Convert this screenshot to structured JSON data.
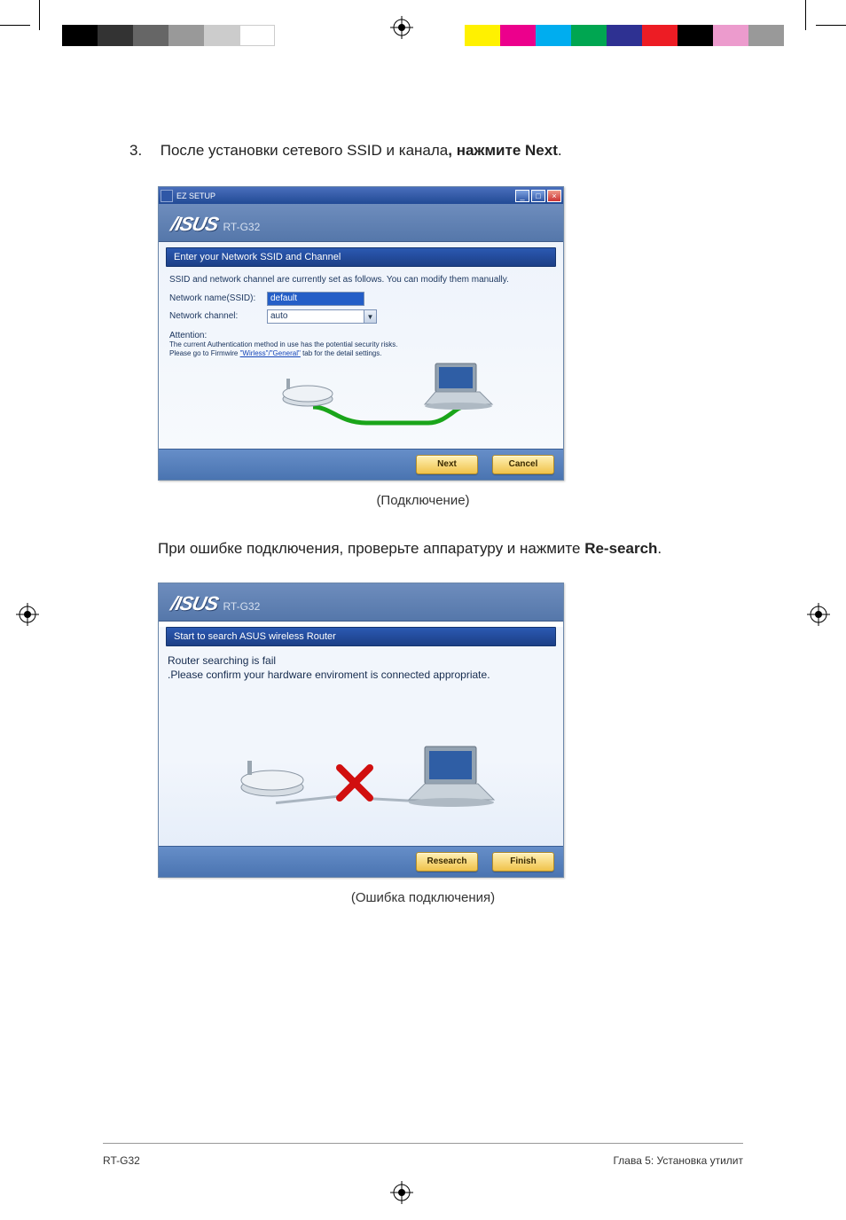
{
  "step": {
    "number": "3.",
    "text_before": "После установки сетевого SSID и канала",
    "text_bold1": ", нажмите ",
    "text_bold2": "Next",
    "text_after": "."
  },
  "shot1": {
    "window_title": "EZ SETUP",
    "model": "RT-G32",
    "bluebar": "Enter your Network SSID and Channel",
    "info": "SSID and network channel are currently set as follows. You can modify them manually.",
    "ssid_label": "Network name(SSID):",
    "ssid_value": "default",
    "chan_label": "Network channel:",
    "chan_value": "auto",
    "attn_head": "Attention:",
    "attn1": "The current Authentication method in use has the potential security risks.",
    "attn2a": "Please go to Firmwire ",
    "attn_link": "\"Wirless\"/\"General\"",
    "attn2b": " tab for the detail settings.",
    "btn_next": "Next",
    "btn_cancel": "Cancel"
  },
  "caption1": "(Подключение)",
  "para2_before": "При ошибке подключения, проверьте аппаратуру и нажмите ",
  "para2_bold": "Re-search",
  "para2_after": ".",
  "shot2": {
    "model": "RT-G32",
    "bluebar": "Start to search ASUS wireless Router",
    "msg1": "Router searching is fail",
    "msg2": ".Please confirm your hardware enviroment is connected appropriate.",
    "btn_research": "Research",
    "btn_finish": "Finish"
  },
  "caption2": "(Ошибка подключения)",
  "footer": {
    "left": "RT-G32",
    "right": "Глава 5: Установка утилит"
  },
  "swatches_l": [
    "#000",
    "#333",
    "#666",
    "#999",
    "#ccc",
    "#fff"
  ],
  "swatches_r": [
    "#fff100",
    "#ec008c",
    "#00adef",
    "#00a651",
    "#2e3192",
    "#ed1c24",
    "#000",
    "#ec9bcd",
    "#999"
  ]
}
